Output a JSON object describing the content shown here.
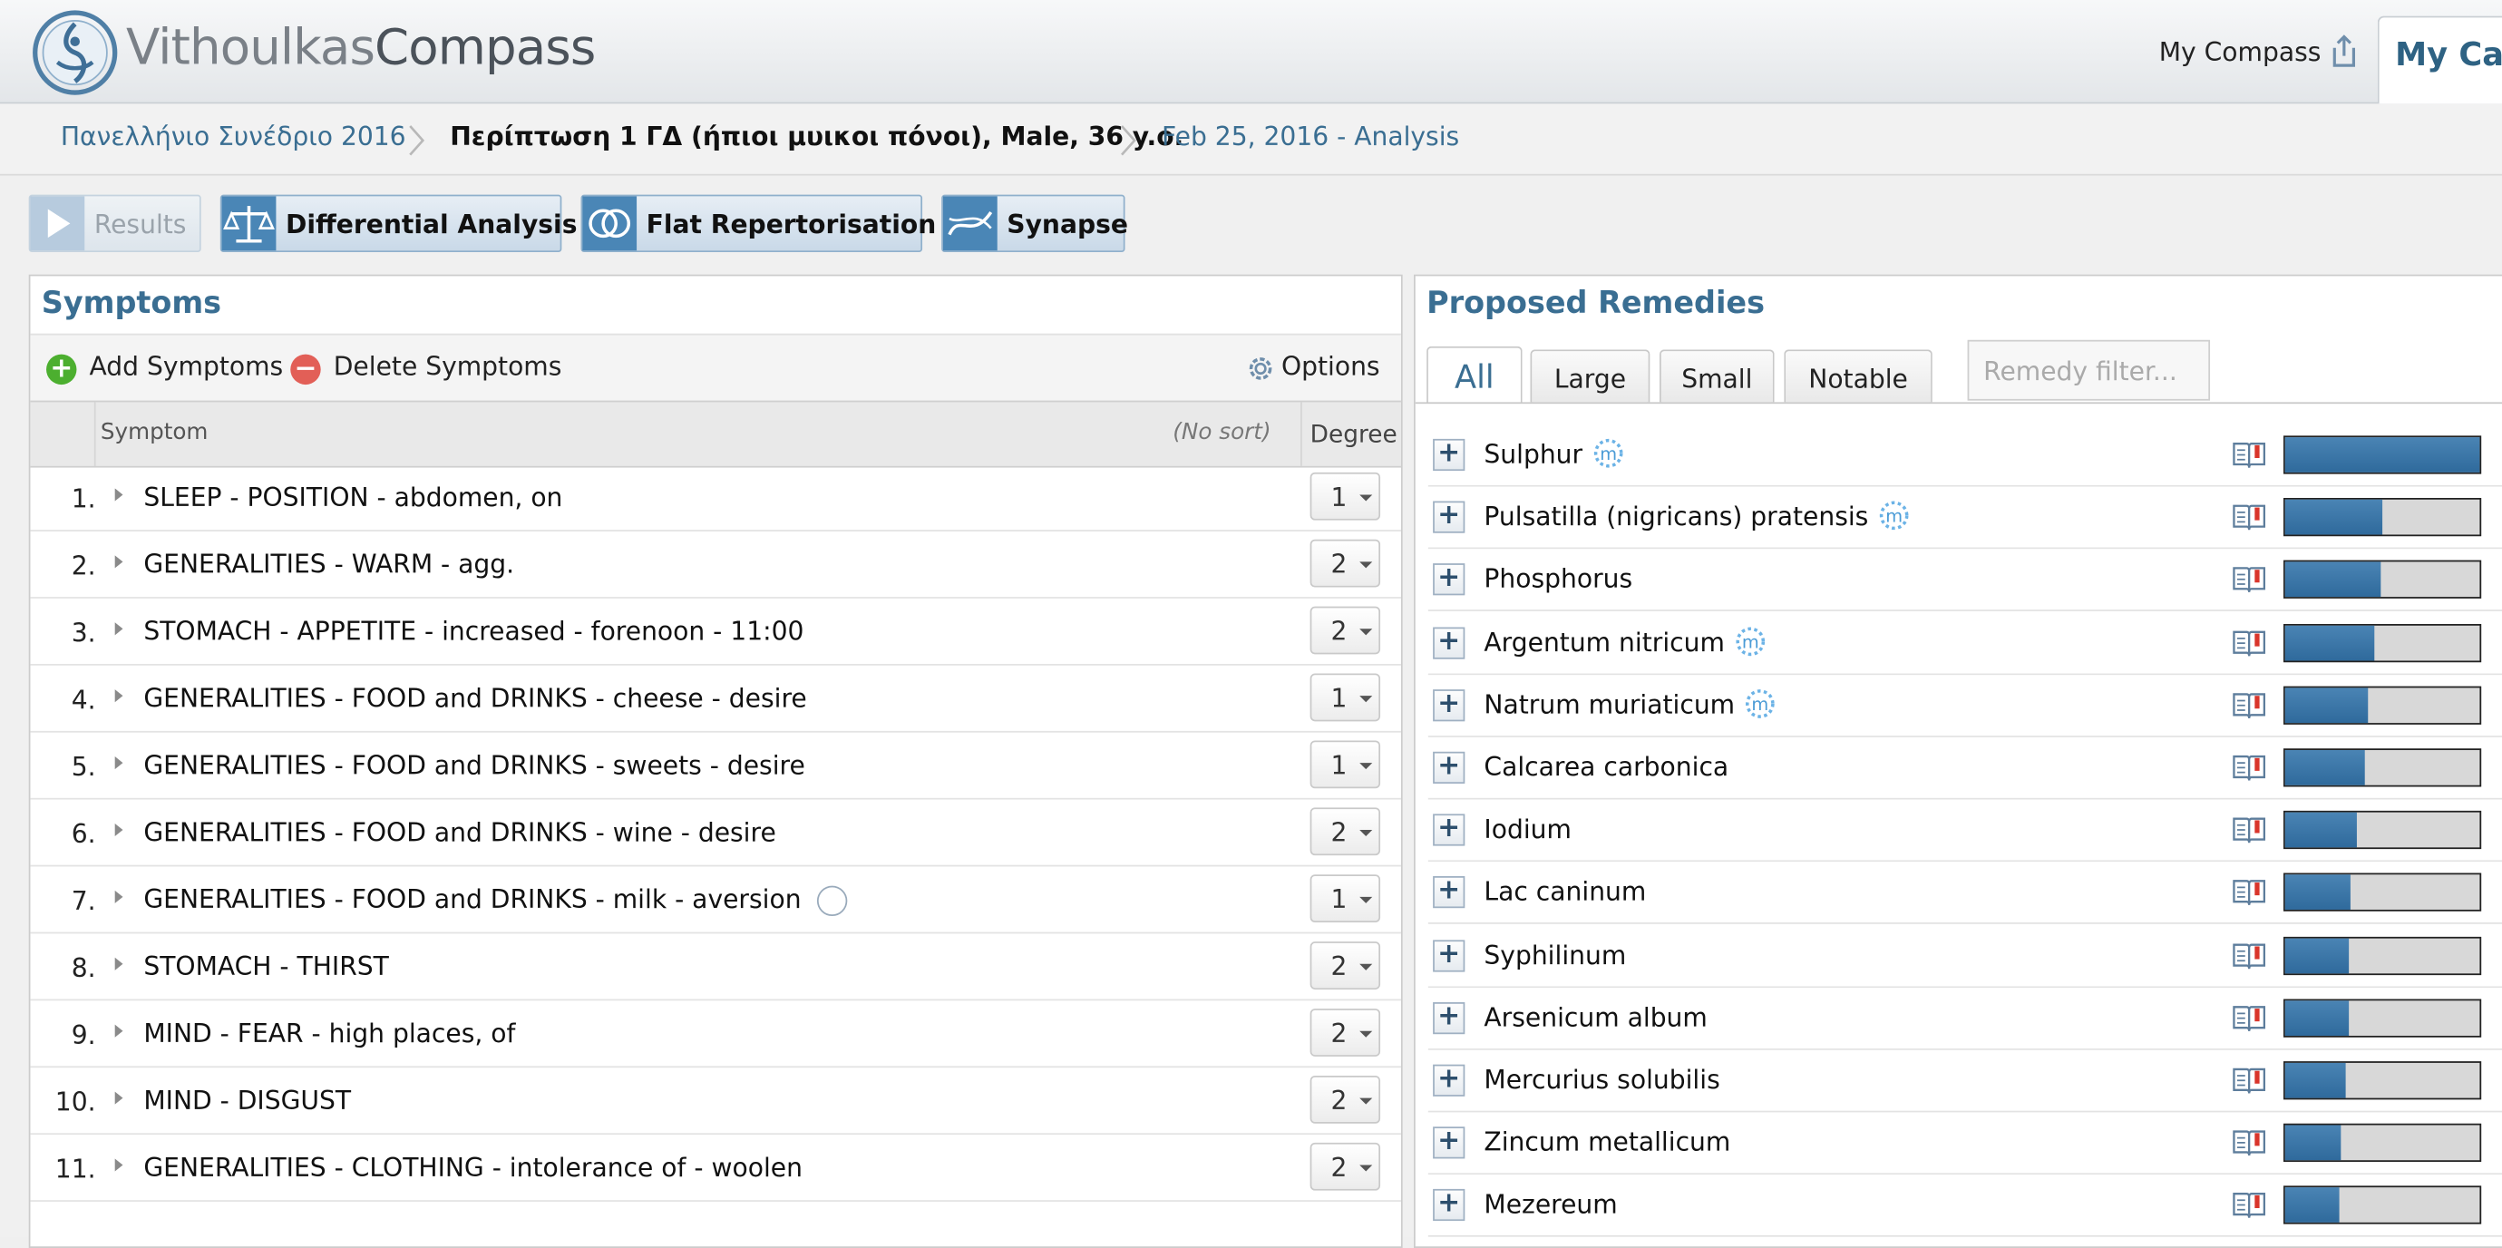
{
  "app": {
    "brand_part1": "Vithoulkas",
    "brand_part2": "Compass"
  },
  "header": {
    "my_compass": "My Compass",
    "my_cases": "My Cases"
  },
  "breadcrumb": {
    "conference": "Πανελλήνιο Συνέδριο 2016",
    "case": "Περίπτωση 1 ΓΔ (ήπιοι μυικοι πόνοι), Male, 36 y.o.",
    "analysis": "Feb 25, 2016 - Analysis"
  },
  "toolbar": {
    "results": "Results",
    "differential": "Differential Analysis",
    "flat": "Flat Repertorisation",
    "synapse": "Synapse"
  },
  "symptoms": {
    "title": "Symptoms",
    "add": "Add Symptoms",
    "delete": "Delete Symptoms",
    "options": "Options",
    "col_symptom": "Symptom",
    "col_sort": "(No sort)",
    "col_degree": "Degree",
    "rows": [
      {
        "num": "1.",
        "text": "SLEEP - POSITION - abdomen, on",
        "degree": "1",
        "ring": false
      },
      {
        "num": "2.",
        "text": "GENERALITIES - WARM - agg.",
        "degree": "2",
        "ring": false
      },
      {
        "num": "3.",
        "text": "STOMACH - APPETITE - increased - forenoon - 11:00",
        "degree": "2",
        "ring": false
      },
      {
        "num": "4.",
        "text": "GENERALITIES - FOOD and DRINKS - cheese - desire",
        "degree": "1",
        "ring": false
      },
      {
        "num": "5.",
        "text": "GENERALITIES - FOOD and DRINKS - sweets - desire",
        "degree": "1",
        "ring": false
      },
      {
        "num": "6.",
        "text": "GENERALITIES - FOOD and DRINKS - wine - desire",
        "degree": "2",
        "ring": false
      },
      {
        "num": "7.",
        "text": "GENERALITIES - FOOD and DRINKS - milk - aversion",
        "degree": "1",
        "ring": true
      },
      {
        "num": "8.",
        "text": "STOMACH - THIRST",
        "degree": "2",
        "ring": false
      },
      {
        "num": "9.",
        "text": "MIND - FEAR - high places, of",
        "degree": "2",
        "ring": false
      },
      {
        "num": "10.",
        "text": "MIND - DISGUST",
        "degree": "2",
        "ring": false
      },
      {
        "num": "11.",
        "text": "GENERALITIES - CLOTHING - intolerance of - woolen",
        "degree": "2",
        "ring": false
      }
    ]
  },
  "remedies": {
    "title": "Proposed Remedies",
    "tabs": [
      "All",
      "Large",
      "Small",
      "Notable"
    ],
    "filter_placeholder": "Remedy filter...",
    "rows": [
      {
        "name": "Sulphur",
        "materia_icon": true,
        "score": 1.0
      },
      {
        "name": "Pulsatilla (nigricans) pratensis",
        "materia_icon": true,
        "score": 0.5
      },
      {
        "name": "Phosphorus",
        "materia_icon": false,
        "score": 0.49
      },
      {
        "name": "Argentum nitricum",
        "materia_icon": true,
        "score": 0.46
      },
      {
        "name": "Natrum muriaticum",
        "materia_icon": true,
        "score": 0.43
      },
      {
        "name": "Calcarea carbonica",
        "materia_icon": false,
        "score": 0.41
      },
      {
        "name": "Iodium",
        "materia_icon": false,
        "score": 0.37
      },
      {
        "name": "Lac caninum",
        "materia_icon": false,
        "score": 0.34
      },
      {
        "name": "Syphilinum",
        "materia_icon": false,
        "score": 0.33
      },
      {
        "name": "Arsenicum album",
        "materia_icon": false,
        "score": 0.33
      },
      {
        "name": "Mercurius solubilis",
        "materia_icon": false,
        "score": 0.31
      },
      {
        "name": "Zincum metallicum",
        "materia_icon": false,
        "score": 0.29
      },
      {
        "name": "Mezereum",
        "materia_icon": false,
        "score": 0.28
      }
    ]
  },
  "colors": {
    "accent": "#3a6e92",
    "bar_fill": "#3b76a8",
    "button_icon": "#4a86b6"
  }
}
